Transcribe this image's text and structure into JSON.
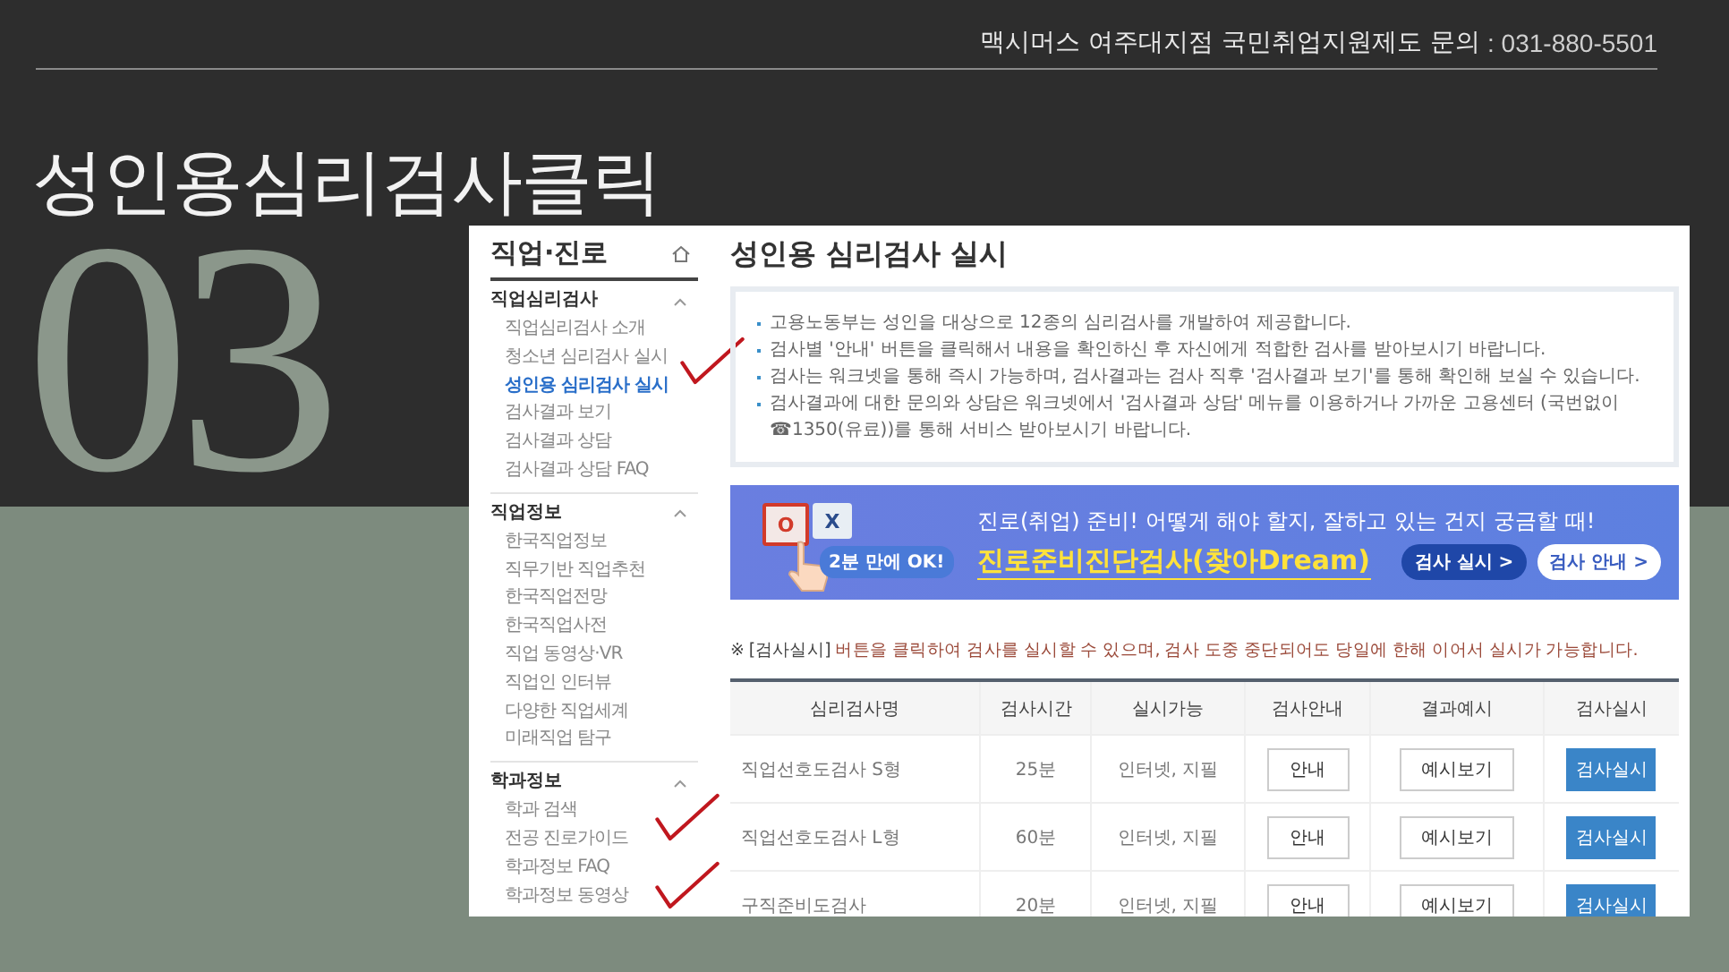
{
  "header": {
    "text": "맥시머스 여주대지점 국민취업지원제도 문의",
    "phone": ": 031-880-5501"
  },
  "slide_title": "성인용심리검사클릭",
  "slide_number": "03",
  "sidebar": {
    "title": "직업·진로",
    "sections": [
      {
        "title": "직업심리검사",
        "expanded": true,
        "items": [
          {
            "label": "직업심리검사 소개",
            "selected": false
          },
          {
            "label": "청소년 심리검사 실시",
            "selected": false
          },
          {
            "label": "성인용 심리검사 실시",
            "selected": true,
            "annotated": true
          },
          {
            "label": "검사결과 보기",
            "selected": false
          },
          {
            "label": "검사결과 상담",
            "selected": false
          },
          {
            "label": "검사결과 상담 FAQ",
            "selected": false
          }
        ]
      },
      {
        "title": "직업정보",
        "expanded": true,
        "items": [
          {
            "label": "한국직업정보",
            "selected": false
          },
          {
            "label": "직무기반 직업추천",
            "selected": false
          },
          {
            "label": "한국직업전망",
            "selected": false
          },
          {
            "label": "한국직업사전",
            "selected": false
          },
          {
            "label": "직업 동영상·VR",
            "selected": false
          },
          {
            "label": "직업인 인터뷰",
            "selected": false
          },
          {
            "label": "다양한 직업세계",
            "selected": false
          },
          {
            "label": "미래직업 탐구",
            "selected": false
          }
        ]
      },
      {
        "title": "학과정보",
        "expanded": true,
        "items": [
          {
            "label": "학과 검색",
            "selected": false
          },
          {
            "label": "전공 진로가이드",
            "selected": false
          },
          {
            "label": "학과정보 FAQ",
            "selected": false
          },
          {
            "label": "학과정보 동영상",
            "selected": false
          }
        ]
      }
    ]
  },
  "page_title": "성인용 심리검사 실시",
  "info": [
    "고용노동부는 성인을 대상으로 12종의 심리검사를 개발하여 제공합니다.",
    "검사별 '안내' 버튼을 클릭해서 내용을 확인하신 후 자신에게 적합한 검사를 받아보시기 바랍니다.",
    "검사는 워크넷을 통해 즉시 가능하며, 검사결과는 검사 직후 '검사결과 보기'를 통해 확인해 보실 수 있습니다.",
    "검사결과에 대한 문의와 상담은 워크넷에서 '검사결과 상담' 메뉴를 이용하거나 가까운 고용센터 (국번없이 ☎1350(유료))를 통해 서비스 받아보시기 바랍니다."
  ],
  "banner": {
    "badge": "2분 만에 OK!",
    "card_o": "O",
    "card_x": "X",
    "headline": "진로(취업) 준비! 어떻게 해야 할지, 잘하고 있는 건지 궁금할 때!",
    "title": "진로준비진단검사(찾아Dream)",
    "buttons": [
      {
        "label": "검사 실시 >",
        "kind": "primary"
      },
      {
        "label": "검사 안내 >",
        "kind": "secondary"
      }
    ]
  },
  "note": {
    "prefix": "※ [검사실시]",
    "text": " 버튼을 클릭하여 검사를 실시할 수 있으며, 검사 도중 중단되어도 당일에 한해 이어서 실시가 가능합니다."
  },
  "table": {
    "columns": [
      "심리검사명",
      "검사시간",
      "실시가능",
      "검사안내",
      "결과예시",
      "검사실시"
    ],
    "rows": [
      {
        "name": "직업선호도검사 S형",
        "time": "25분",
        "method": "인터넷, 지필",
        "guide": "안내",
        "example": "예시보기",
        "start": "검사실시",
        "annotated": false
      },
      {
        "name": "직업선호도검사 L형",
        "time": "60분",
        "method": "인터넷, 지필",
        "guide": "안내",
        "example": "예시보기",
        "start": "검사실시",
        "annotated": true
      },
      {
        "name": "구직준비도검사",
        "time": "20분",
        "method": "인터넷, 지필",
        "guide": "안내",
        "example": "예시보기",
        "start": "검사실시",
        "annotated": true
      }
    ]
  }
}
